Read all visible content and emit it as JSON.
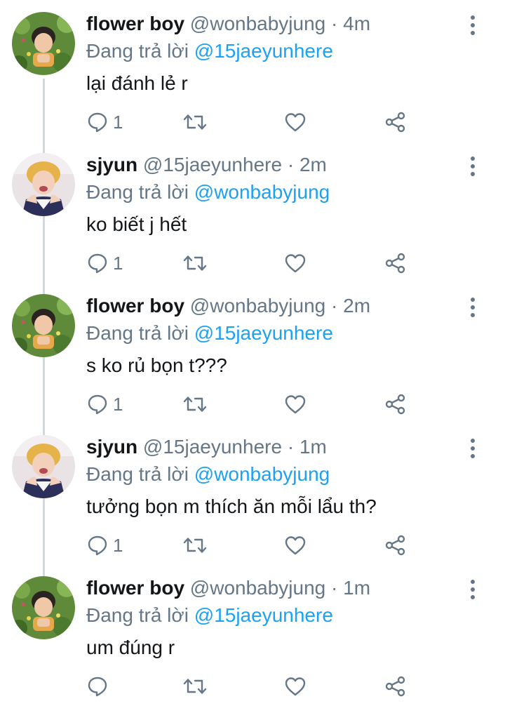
{
  "thread": {
    "reply_prefix": "Đang trả lời",
    "tweets": [
      {
        "display_name": "flower boy",
        "handle": "@wonbabyjung",
        "separator": "·",
        "time": "4m",
        "replying_to": "@15jaeyunhere",
        "text": "lại đánh lẻ r",
        "reply_count": "1",
        "avatar": "avatar-flowerboy"
      },
      {
        "display_name": "sjyun",
        "handle": "@15jaeyunhere",
        "separator": "·",
        "time": "2m",
        "replying_to": "@wonbabyjung",
        "text": "ko biết j hết",
        "reply_count": "1",
        "avatar": "avatar-sjyun"
      },
      {
        "display_name": "flower boy",
        "handle": "@wonbabyjung",
        "separator": "·",
        "time": "2m",
        "replying_to": "@15jaeyunhere",
        "text": "s ko rủ bọn t???",
        "reply_count": "1",
        "avatar": "avatar-flowerboy"
      },
      {
        "display_name": "sjyun",
        "handle": "@15jaeyunhere",
        "separator": "·",
        "time": "1m",
        "replying_to": "@wonbabyjung",
        "text": "tưởng bọn m thích ăn mỗi lẩu th?",
        "reply_count": "1",
        "avatar": "avatar-sjyun"
      },
      {
        "display_name": "flower boy",
        "handle": "@wonbabyjung",
        "separator": "·",
        "time": "1m",
        "replying_to": "@15jaeyunhere",
        "text": "um đúng r",
        "reply_count": "",
        "avatar": "avatar-flowerboy"
      }
    ]
  },
  "colors": {
    "text": "#14171a",
    "secondary": "#657786",
    "link": "#1da1f2",
    "connector": "#cfd9de"
  },
  "icons": {
    "reply": "reply-icon",
    "retweet": "retweet-icon",
    "like": "heart-icon",
    "share": "share-icon",
    "more": "more-vertical-icon"
  }
}
